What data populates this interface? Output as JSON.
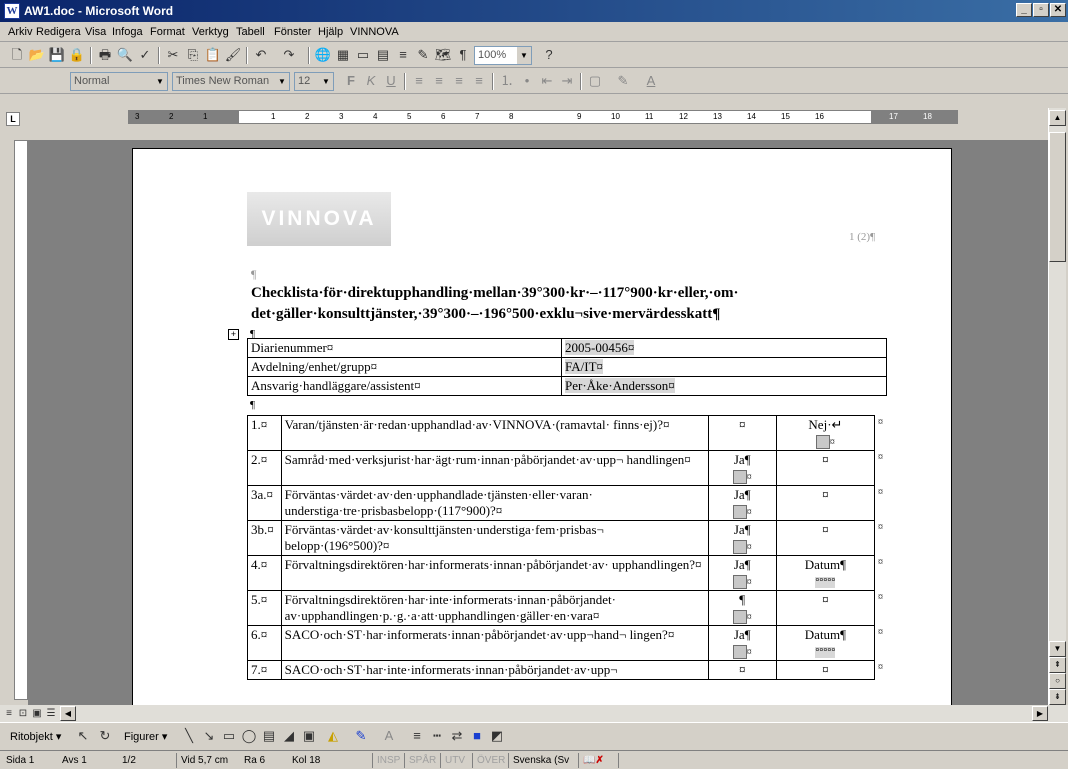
{
  "window": {
    "title": "AW1.doc - Microsoft Word",
    "icon": "word-icon"
  },
  "menu": [
    "Arkiv",
    "Redigera",
    "Visa",
    "Infoga",
    "Format",
    "Verktyg",
    "Tabell",
    "Fönster",
    "Hjälp",
    "VINNOVA"
  ],
  "toolbar": {
    "zoom": "100%",
    "style": "Normal",
    "font": "Times New Roman",
    "size": "12"
  },
  "ruler": {
    "labels_left": [
      "3",
      "2",
      "1"
    ],
    "labels_right": [
      "1",
      "2",
      "3",
      "4",
      "5",
      "6",
      "7",
      "8",
      "9",
      "10",
      "11",
      "12",
      "13",
      "14",
      "15",
      "16",
      "17",
      "18"
    ]
  },
  "document": {
    "logo": "VINNOVA",
    "page_number": "1 (2)¶",
    "pilcrow": "¶",
    "heading": "Checklista·för·direktupphandling·mellan·39°300·kr·–·117°900·kr·eller,·om· det·gäller·konsulttjänster,·39°300·–·196°500·exklu¬sive·mervärdesskatt¶",
    "info_rows": [
      {
        "label": "Diarienummer¤",
        "value": "2005-00456¤"
      },
      {
        "label": "Avdelning/enhet/grupp¤",
        "value": "FA/IT¤"
      },
      {
        "label": "Ansvarig·handläggare/assistent¤",
        "value": "Per·Åke·Andersson¤"
      }
    ],
    "checklist": [
      {
        "num": "1.¤",
        "text": "Varan/tjänsten·är·redan·upphandlad·av·VINNOVA·(ramavtal· finns·ej)?¤",
        "c1": "¤",
        "c1_box": false,
        "c2": "Nej·↵",
        "c2_box": true
      },
      {
        "num": "2.¤",
        "text": "Samråd·med·verksjurist·har·ägt·rum·innan·påbörjandet·av·upp¬ handlingen¤",
        "c1": "Ja¶",
        "c1_box": true,
        "c2": "¤",
        "c2_box": false
      },
      {
        "num": "3a.¤",
        "text": "Förväntas·värdet·av·den·upphandlade·tjänsten·eller·varan· understiga·tre·prisbasbelopp·(117°900)?¤",
        "c1": "Ja¶",
        "c1_box": true,
        "c2": "¤",
        "c2_box": false
      },
      {
        "num": "3b.¤",
        "text": "Förväntas·värdet·av·konsulttjänsten·understiga·fem·prisbas¬ belopp·(196°500)?¤",
        "c1": "Ja¶",
        "c1_box": true,
        "c2": "¤",
        "c2_box": false
      },
      {
        "num": "4.¤",
        "text": "Förvaltningsdirektören·har·informerats·innan·påbörjandet·av· upphandlingen?¤",
        "c1": "Ja¶",
        "c1_box": true,
        "c2": "Datum¶",
        "c2_date": "°°°°°"
      },
      {
        "num": "5.¤",
        "text": "Förvaltningsdirektören·har·inte·informerats·innan·påbörjandet· av·upphandlingen·p.·g.·a·att·upphandlingen·gäller·en·vara¤",
        "c1": "¶",
        "c1_box": true,
        "c2": "¤",
        "c2_box": false
      },
      {
        "num": "6.¤",
        "text": "SACO·och·ST·har·informerats·innan·påbörjandet·av·upp¬hand¬ lingen?¤",
        "c1": "Ja¶",
        "c1_box": true,
        "c2": "Datum¶",
        "c2_date": "°°°°°"
      },
      {
        "num": "7.¤",
        "text": "SACO·och·ST·har·inte·informerats·innan·påbörjandet·av·upp¬",
        "c1": "¤",
        "c1_box": false,
        "c2": "¤",
        "c2_box": false
      }
    ],
    "cell_end": "¤"
  },
  "drawbar": {
    "ritobjekt": "Ritobjekt",
    "figurer": "Figurer"
  },
  "status": {
    "sida": "Sida 1",
    "avs": "Avs 1",
    "pages": "1/2",
    "vid": "Vid 5,7 cm",
    "ra": "Ra 6",
    "kol": "Kol 18",
    "insp": "INSP",
    "spar": "SPÅR",
    "utv": "UTV",
    "over": "ÖVER",
    "lang": "Svenska (Sv"
  }
}
